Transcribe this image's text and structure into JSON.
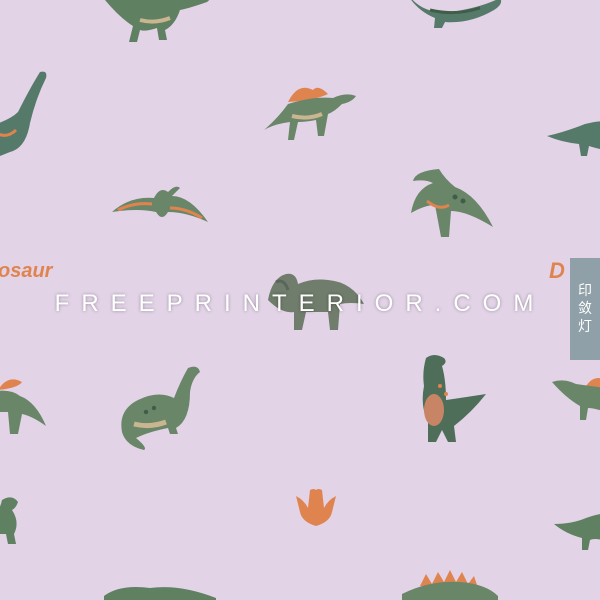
{
  "pattern": {
    "background_color": "#e2d3e7",
    "dino_green": "#5f8061",
    "dino_dark": "#3f5d49",
    "accent_orange": "#e0844f",
    "belly": "#c9b58f"
  },
  "labels": {
    "left_fragment": "osaur",
    "right_fragment": "D"
  },
  "watermark": {
    "text": "FREEPRINTERIOR.COM"
  },
  "badge": {
    "chars": [
      "印",
      "敛",
      "灯"
    ]
  },
  "icons": [
    "trex-icon",
    "sauropod-icon",
    "spinosaurus-icon",
    "pterodactyl-icon",
    "parasaurolophus-icon",
    "triceratops-icon",
    "stegosaurus-icon",
    "footprint-icon"
  ]
}
